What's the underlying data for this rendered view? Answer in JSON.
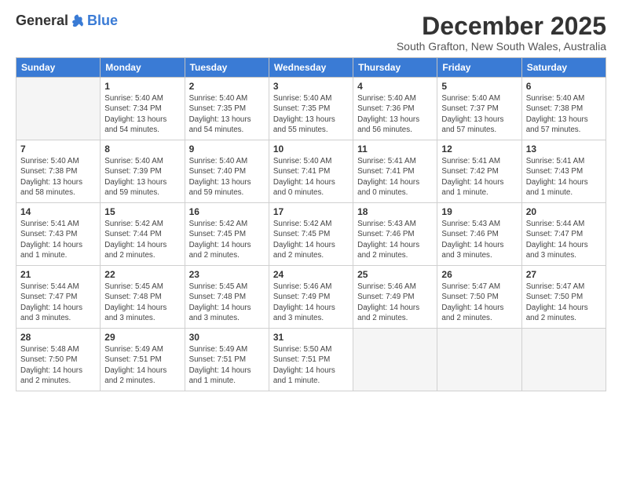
{
  "header": {
    "logo_general": "General",
    "logo_blue": "Blue",
    "month_title": "December 2025",
    "location": "South Grafton, New South Wales, Australia"
  },
  "days_of_week": [
    "Sunday",
    "Monday",
    "Tuesday",
    "Wednesday",
    "Thursday",
    "Friday",
    "Saturday"
  ],
  "weeks": [
    [
      {
        "day": "",
        "info": ""
      },
      {
        "day": "1",
        "info": "Sunrise: 5:40 AM\nSunset: 7:34 PM\nDaylight: 13 hours\nand 54 minutes."
      },
      {
        "day": "2",
        "info": "Sunrise: 5:40 AM\nSunset: 7:35 PM\nDaylight: 13 hours\nand 54 minutes."
      },
      {
        "day": "3",
        "info": "Sunrise: 5:40 AM\nSunset: 7:35 PM\nDaylight: 13 hours\nand 55 minutes."
      },
      {
        "day": "4",
        "info": "Sunrise: 5:40 AM\nSunset: 7:36 PM\nDaylight: 13 hours\nand 56 minutes."
      },
      {
        "day": "5",
        "info": "Sunrise: 5:40 AM\nSunset: 7:37 PM\nDaylight: 13 hours\nand 57 minutes."
      },
      {
        "day": "6",
        "info": "Sunrise: 5:40 AM\nSunset: 7:38 PM\nDaylight: 13 hours\nand 57 minutes."
      }
    ],
    [
      {
        "day": "7",
        "info": "Sunrise: 5:40 AM\nSunset: 7:38 PM\nDaylight: 13 hours\nand 58 minutes."
      },
      {
        "day": "8",
        "info": "Sunrise: 5:40 AM\nSunset: 7:39 PM\nDaylight: 13 hours\nand 59 minutes."
      },
      {
        "day": "9",
        "info": "Sunrise: 5:40 AM\nSunset: 7:40 PM\nDaylight: 13 hours\nand 59 minutes."
      },
      {
        "day": "10",
        "info": "Sunrise: 5:40 AM\nSunset: 7:41 PM\nDaylight: 14 hours\nand 0 minutes."
      },
      {
        "day": "11",
        "info": "Sunrise: 5:41 AM\nSunset: 7:41 PM\nDaylight: 14 hours\nand 0 minutes."
      },
      {
        "day": "12",
        "info": "Sunrise: 5:41 AM\nSunset: 7:42 PM\nDaylight: 14 hours\nand 1 minute."
      },
      {
        "day": "13",
        "info": "Sunrise: 5:41 AM\nSunset: 7:43 PM\nDaylight: 14 hours\nand 1 minute."
      }
    ],
    [
      {
        "day": "14",
        "info": "Sunrise: 5:41 AM\nSunset: 7:43 PM\nDaylight: 14 hours\nand 1 minute."
      },
      {
        "day": "15",
        "info": "Sunrise: 5:42 AM\nSunset: 7:44 PM\nDaylight: 14 hours\nand 2 minutes."
      },
      {
        "day": "16",
        "info": "Sunrise: 5:42 AM\nSunset: 7:45 PM\nDaylight: 14 hours\nand 2 minutes."
      },
      {
        "day": "17",
        "info": "Sunrise: 5:42 AM\nSunset: 7:45 PM\nDaylight: 14 hours\nand 2 minutes."
      },
      {
        "day": "18",
        "info": "Sunrise: 5:43 AM\nSunset: 7:46 PM\nDaylight: 14 hours\nand 2 minutes."
      },
      {
        "day": "19",
        "info": "Sunrise: 5:43 AM\nSunset: 7:46 PM\nDaylight: 14 hours\nand 3 minutes."
      },
      {
        "day": "20",
        "info": "Sunrise: 5:44 AM\nSunset: 7:47 PM\nDaylight: 14 hours\nand 3 minutes."
      }
    ],
    [
      {
        "day": "21",
        "info": "Sunrise: 5:44 AM\nSunset: 7:47 PM\nDaylight: 14 hours\nand 3 minutes."
      },
      {
        "day": "22",
        "info": "Sunrise: 5:45 AM\nSunset: 7:48 PM\nDaylight: 14 hours\nand 3 minutes."
      },
      {
        "day": "23",
        "info": "Sunrise: 5:45 AM\nSunset: 7:48 PM\nDaylight: 14 hours\nand 3 minutes."
      },
      {
        "day": "24",
        "info": "Sunrise: 5:46 AM\nSunset: 7:49 PM\nDaylight: 14 hours\nand 3 minutes."
      },
      {
        "day": "25",
        "info": "Sunrise: 5:46 AM\nSunset: 7:49 PM\nDaylight: 14 hours\nand 2 minutes."
      },
      {
        "day": "26",
        "info": "Sunrise: 5:47 AM\nSunset: 7:50 PM\nDaylight: 14 hours\nand 2 minutes."
      },
      {
        "day": "27",
        "info": "Sunrise: 5:47 AM\nSunset: 7:50 PM\nDaylight: 14 hours\nand 2 minutes."
      }
    ],
    [
      {
        "day": "28",
        "info": "Sunrise: 5:48 AM\nSunset: 7:50 PM\nDaylight: 14 hours\nand 2 minutes."
      },
      {
        "day": "29",
        "info": "Sunrise: 5:49 AM\nSunset: 7:51 PM\nDaylight: 14 hours\nand 2 minutes."
      },
      {
        "day": "30",
        "info": "Sunrise: 5:49 AM\nSunset: 7:51 PM\nDaylight: 14 hours\nand 1 minute."
      },
      {
        "day": "31",
        "info": "Sunrise: 5:50 AM\nSunset: 7:51 PM\nDaylight: 14 hours\nand 1 minute."
      },
      {
        "day": "",
        "info": ""
      },
      {
        "day": "",
        "info": ""
      },
      {
        "day": "",
        "info": ""
      }
    ]
  ]
}
